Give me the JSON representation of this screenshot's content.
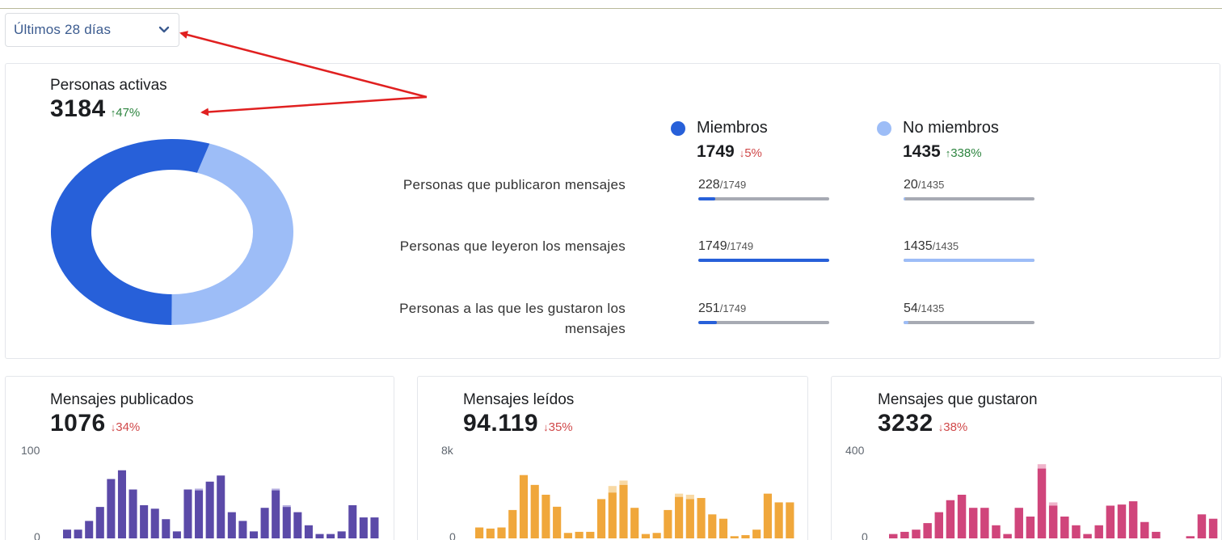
{
  "filter": {
    "selected": "Últimos 28 días"
  },
  "summary": {
    "title": "Personas activas",
    "value": "3184",
    "delta": "47%",
    "delta_dir": "up",
    "colors": {
      "members": "#2760d9",
      "non_members": "#9dbdf7"
    }
  },
  "legend": {
    "members": {
      "label": "Miembros",
      "value": "1749",
      "delta": "5%",
      "delta_dir": "down"
    },
    "non_members": {
      "label": "No miembros",
      "value": "1435",
      "delta": "338%",
      "delta_dir": "up"
    }
  },
  "rows": [
    {
      "label": "Personas que publicaron mensajes",
      "members": {
        "num": "228",
        "den": "/1749",
        "ratio": 0.13
      },
      "non_members": {
        "num": "20",
        "den": "/1435",
        "ratio": 0.014
      }
    },
    {
      "label": "Personas que leyeron los mensajes",
      "members": {
        "num": "1749",
        "den": "/1749",
        "ratio": 1.0
      },
      "non_members": {
        "num": "1435",
        "den": "/1435",
        "ratio": 1.0
      }
    },
    {
      "label_line1": "Personas a las que les gustaron los",
      "label_line2": "mensajes",
      "members": {
        "num": "251",
        "den": "/1749",
        "ratio": 0.143
      },
      "non_members": {
        "num": "54",
        "den": "/1435",
        "ratio": 0.038
      }
    }
  ],
  "chart_data": [
    {
      "type": "bar",
      "title": "Mensajes publicados",
      "value": "1076",
      "delta": "34%",
      "delta_dir": "down",
      "ylim": [
        0,
        100
      ],
      "yticks": [
        "100",
        "0"
      ],
      "color": "#5b4aa8",
      "color_light": "#b5aee0",
      "values": [
        10,
        10,
        20,
        36,
        68,
        78,
        56,
        38,
        34,
        22,
        8,
        56,
        55,
        65,
        72,
        30,
        20,
        8,
        35,
        55,
        36,
        30,
        15,
        5,
        5,
        8,
        38,
        24,
        24
      ],
      "extra": [
        0,
        0,
        0,
        0,
        0,
        0,
        0,
        0,
        0,
        0,
        0,
        0,
        2,
        0,
        0,
        0,
        0,
        0,
        0,
        2,
        2,
        0,
        0,
        0,
        0,
        0,
        0,
        0,
        0
      ]
    },
    {
      "type": "bar",
      "title": "Mensajes leídos",
      "value": "94.119",
      "delta": "35%",
      "delta_dir": "down",
      "ylim": [
        0,
        8000
      ],
      "yticks": [
        "8k",
        "0"
      ],
      "color": "#f0a73b",
      "color_light": "#f8d9a4",
      "values": [
        1000,
        900,
        1000,
        2600,
        5800,
        4900,
        4000,
        2900,
        500,
        600,
        600,
        3600,
        4200,
        4900,
        2800,
        400,
        500,
        2600,
        3800,
        3600,
        3700,
        2200,
        1800,
        200,
        300,
        800,
        4100,
        3300,
        3300
      ],
      "extra": [
        0,
        0,
        0,
        0,
        0,
        0,
        0,
        0,
        0,
        0,
        0,
        0,
        600,
        400,
        0,
        0,
        0,
        0,
        300,
        400,
        0,
        0,
        0,
        0,
        0,
        0,
        0,
        0,
        0
      ]
    },
    {
      "type": "bar",
      "title": "Mensajes que gustaron",
      "value": "3232",
      "delta": "38%",
      "delta_dir": "down",
      "ylim": [
        0,
        400
      ],
      "yticks": [
        "400",
        "0"
      ],
      "color": "#d0457b",
      "color_light": "#efb3ca",
      "values": [
        20,
        30,
        40,
        70,
        120,
        175,
        200,
        140,
        140,
        60,
        20,
        140,
        100,
        320,
        150,
        100,
        60,
        20,
        60,
        150,
        155,
        170,
        75,
        30,
        0,
        0,
        10,
        110,
        90
      ],
      "extra": [
        0,
        0,
        0,
        0,
        0,
        0,
        0,
        0,
        0,
        0,
        0,
        0,
        0,
        20,
        15,
        0,
        0,
        0,
        0,
        0,
        0,
        0,
        0,
        0,
        0,
        0,
        0,
        0,
        0
      ]
    }
  ]
}
